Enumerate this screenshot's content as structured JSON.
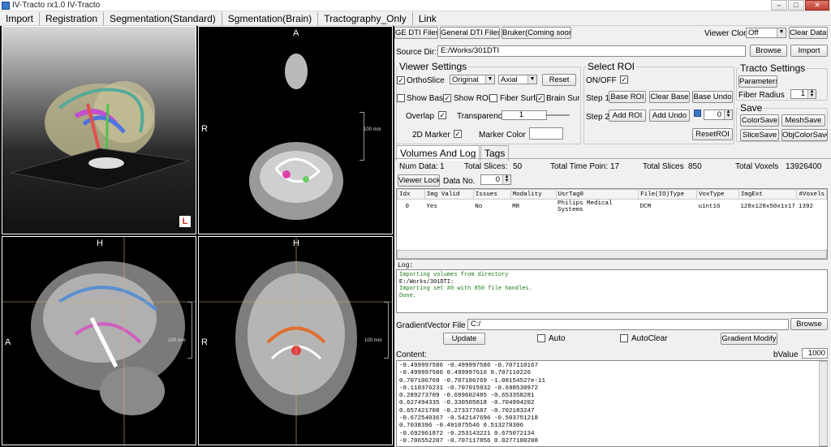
{
  "window": {
    "title": "IV-Tracto rx1.0 IV-Tracto"
  },
  "menu": [
    "Import",
    "Registration",
    "Segmentation(Standard)",
    "Sgmentation(Brain)",
    "Tractography_Only",
    "Link"
  ],
  "views": {
    "axial_top": "A",
    "axial_left": "R",
    "sagittal_top": "H",
    "sagittal_left": "A",
    "coronal_top": "H",
    "coronal_left": "R",
    "scale": "100 mm",
    "orient_marker": "L"
  },
  "toolbar": {
    "ge_dti": "GE DTI Files",
    "general_dti": "General DTI Files",
    "bruker": "Bruker(Coming soon)",
    "viewer_clone_label": "Viewer Clone",
    "viewer_clone_value": "Off",
    "clear_data": "Clear Data!"
  },
  "source": {
    "label": "Source Dir:",
    "value": "E:/Works/301DTI",
    "browse": "Browse",
    "import": "Import"
  },
  "viewer_settings": {
    "title": "Viewer Settings",
    "orthoslice": "OrthoSlice",
    "mode": "Original",
    "plane": "Axial",
    "reset": "Reset",
    "show_base": "Show Base",
    "show_roi": "Show ROI",
    "fiber_surf": "Fiber Surfa",
    "brain_surf": "Brain Surfa",
    "overlap": "Overlap",
    "transparency": "Transparency",
    "transparency_value": "1",
    "marker_2d": "2D Marker",
    "marker_color": "Marker Color"
  },
  "select_roi": {
    "title": "Select ROI",
    "onoff": "ON/OFF",
    "step1": "Step 1:",
    "base_roi": "Base ROI",
    "clear_base": "Clear Base",
    "base_undo": "Base Undo",
    "step2": "Step 2:",
    "add_roi": "Add ROI",
    "add_undo": "Add Undo",
    "roi_count": "0",
    "reset_roi": "ResetROI"
  },
  "tracto_settings": {
    "title": "Tracto Settings",
    "parameters": "Parameters",
    "fiber_radius": "Fiber Radius",
    "fiber_radius_value": "1"
  },
  "save": {
    "title": "Save",
    "color_save": "ColorSave",
    "mesh_save": "MeshSave",
    "slice_save": "SliceSave",
    "obj_color_save": "ObjColorSave"
  },
  "tabs": [
    "Volumes And Log",
    "Tags"
  ],
  "stats": {
    "num_data_label": "Num Data:",
    "num_data": "1",
    "total_slices_label": "Total Slices:",
    "total_slices": "50",
    "total_time_label": "Total Time Poin:",
    "total_time": "17",
    "total_slices2_label": "Total Slices",
    "total_slices2": "850",
    "total_voxels_label": "Total Voxels",
    "total_voxels": "13926400"
  },
  "viewer_lock": "Viewer Lock!",
  "data_no_label": "Data No.",
  "data_no": "0",
  "table": {
    "headers": [
      "Idx",
      "Img Valid",
      "Issues",
      "Modality",
      "UsrTag0",
      "File(IO)Type",
      "VoxType",
      "ImgExt",
      "#Voxels"
    ],
    "rows": [
      [
        "0",
        "Yes",
        "No",
        "MR",
        "Philips Medical Systems",
        "DCM",
        "uint16",
        "128x128x50x1x17",
        "1392"
      ]
    ]
  },
  "log": {
    "label": "Log:",
    "lines": [
      "Importing volumes from directory",
      "E:/Works/301DTI:",
      "Importing set #0 with 850 file handles.",
      "Done."
    ]
  },
  "gradient": {
    "label": "GradientVector File",
    "value": "C:/",
    "browse": "Browse",
    "update": "Update",
    "auto": "Auto",
    "autoclear": "AutoClear",
    "modify": "Gradient Modify",
    "content_label": "Content:",
    "bvalue_label": "bValue",
    "bvalue": "1000"
  },
  "content_lines": [
    "-0.499997586 -0.499997586 -0.707110167",
    "-0.499997586 0.499997616 0.707110226",
    "0.707106769 -0.707106769 -1.08154527e-11",
    "-0.110376231 -0.707015932 -0.698530972",
    "0.289273709 -0.699602485 -0.653358281",
    "0.627494335 -0.330505818 -0.704994202",
    "0.657421708 -0.273377687 -0.702183247",
    "-0.672540367 -0.542147696 -0.503751218",
    "0.7038396 -0.491075546 0.513278306",
    "-0.692961872 -0.253143221 0.675072134",
    "-0.706552207 -0.707117856 0.0277180208"
  ]
}
